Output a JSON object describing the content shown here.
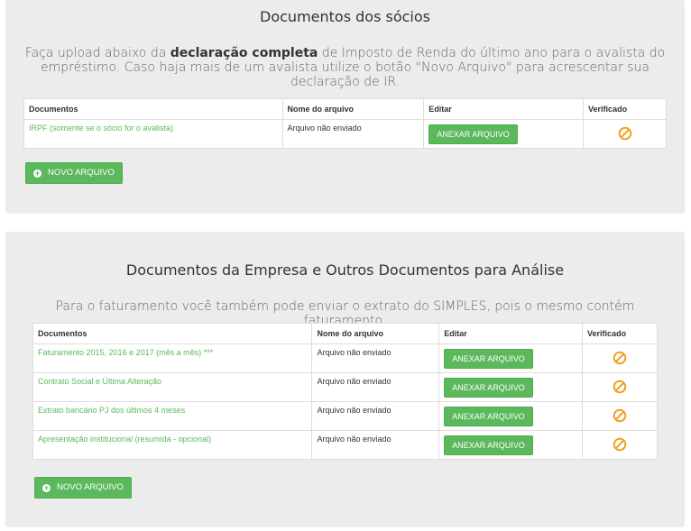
{
  "socios": {
    "title": "Documentos dos sócios",
    "desc_pre": "Faça upload abaixo da ",
    "desc_bold": "declaração completa",
    "desc_post": " de Imposto de Renda do último ano para o avalista do empréstimo. Caso haja mais de um avalista utilize o botão \"Novo Arquivo\" para acrescentar sua declaração de IR.",
    "headers": [
      "Documentos",
      "Nome do arquivo",
      "Editar",
      "Verificado"
    ],
    "rows": [
      {
        "doc": "IRPF (somente se o sócio for o avalista)",
        "file": "Arquivo não enviado",
        "action": "ANEXAR ARQUIVO"
      }
    ],
    "new_button": "NOVO ARQUIVO"
  },
  "empresa": {
    "title": "Documentos da Empresa e Outros Documentos para Análise",
    "desc": "Para o faturamento você também pode enviar o extrato do SIMPLES, pois o mesmo contém faturamento.",
    "headers": [
      "Documentos",
      "Nome do arquivo",
      "Editar",
      "Verificado"
    ],
    "rows": [
      {
        "doc": "Faturamento 2015, 2016 e 2017 (mês a mês) ***",
        "file": "Arquivo não enviado",
        "action": "ANEXAR ARQUIVO"
      },
      {
        "doc": "Contrato Social e Última Alteração",
        "file": "Arquivo não enviado",
        "action": "ANEXAR ARQUIVO"
      },
      {
        "doc": "Extrato bancário PJ dos últimos 4 meses",
        "file": "Arquivo não enviado",
        "action": "ANEXAR ARQUIVO"
      },
      {
        "doc": "Apresentação institucional (resumida - opcional)",
        "file": "Arquivo não enviado",
        "action": "ANEXAR ARQUIVO"
      }
    ],
    "new_button": "NOVO ARQUIVO"
  },
  "icons": {
    "verified": "ban-icon",
    "add": "plus-circle-icon"
  },
  "colors": {
    "accent": "#5cb85c",
    "warning": "#f0a020",
    "panel": "#ececec"
  }
}
